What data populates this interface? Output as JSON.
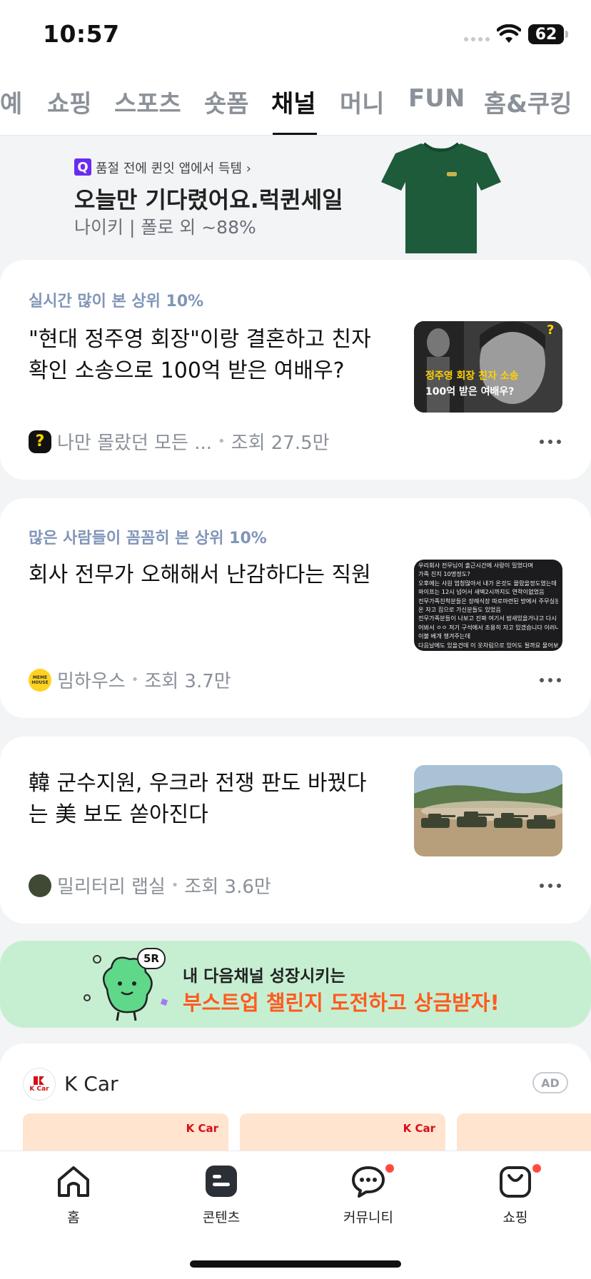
{
  "status_bar": {
    "time": "10:57",
    "battery": "62"
  },
  "tabs": [
    {
      "label": "예",
      "active": false
    },
    {
      "label": "쇼핑",
      "active": false
    },
    {
      "label": "스포츠",
      "active": false
    },
    {
      "label": "숏폼",
      "active": false
    },
    {
      "label": "채널",
      "active": true
    },
    {
      "label": "머니",
      "active": false
    },
    {
      "label": "FUN",
      "active": false
    },
    {
      "label": "홈&쿠킹",
      "active": false
    }
  ],
  "banner": {
    "badge": "Q",
    "subtitle": "품절 전에 퀸잇 앱에서 득템 ›",
    "title": "오늘만 기다렸어요.럭퀸세일",
    "description": "나이키 | 폴로 외 ~88%"
  },
  "feed": [
    {
      "tag": "실시간 많이 본 상위 10%",
      "title": "\"현대 정주영 회장\"이랑 결혼하고 친자 확인 소송으로 100억 받은 여배우?",
      "channel": "나만 몰랐던 모든 ...",
      "views": "조회 27.5만",
      "avatar_text": "?",
      "thumb_caption_1": "정주영 회장 친자 소송",
      "thumb_caption_2": "100억 받은 여배우?",
      "thumb_mark": "?"
    },
    {
      "tag": "많은 사람들이 꼼꼼히 본 상위 10%",
      "title": "회사 전무가 오해해서 난감하다는 직원",
      "channel": "밈하우스",
      "views": "조회 3.7만",
      "avatar_text": "MEME HOUSE",
      "thumb_lines": [
        "우리회사 전무님이 출근시간에 사랑이 밀었다며",
        "가족 친지 10명정도?",
        "오후에는 사원 엄청많아서 내가 온것도 몰랐을정도였는데",
        "와이프는 12시 넘어서 새벽2시까지도 연락이없었음",
        "전무가족친척분들은 장례식장 따로마련된 방에서 주무실분도",
        "온 자고 집으로 가신분들도 있었음",
        "전무가족분들이 나보고 진짜 여기서 밤새있을거냐고 다시 물",
        "어봐서 ㅇㅇ 저기 구석에서 조용히 자고 있겠습니다 이러니까",
        "이불 베개 챙겨주는데",
        "다음날에도 있을건데 이 옷차림으로 있어도 될까요 물어보니"
      ]
    },
    {
      "tag": "",
      "title": "韓 군수지원, 우크라 전쟁 판도 바꿨다는 美 보도 쏟아진다",
      "channel": "밀리터리 랩실",
      "views": "조회 3.6만",
      "avatar_text": ""
    }
  ],
  "promo": {
    "badge": "5R",
    "line1": "내 다음채널 성장시키는",
    "line2": "부스트업 챌린지 도전하고 상금받자!"
  },
  "ad": {
    "brand": "K Car",
    "logo_text": "K Car",
    "badge": "AD",
    "tile_brand": "K Car"
  },
  "bottom_nav": [
    {
      "label": "홈",
      "icon": "home-icon",
      "dot": false
    },
    {
      "label": "콘텐츠",
      "icon": "contents-icon",
      "dot": false
    },
    {
      "label": "커뮤니티",
      "icon": "chat-bubble-icon",
      "dot": true
    },
    {
      "label": "쇼핑",
      "icon": "shopping-bag-icon",
      "dot": true
    }
  ],
  "colors": {
    "accent_tag": "#8095b8",
    "promo_bg": "#c6efd2",
    "promo_highlight": "#ff5a1f",
    "notification_dot": "#ff4d3d",
    "kcar_red": "#d60f16"
  }
}
